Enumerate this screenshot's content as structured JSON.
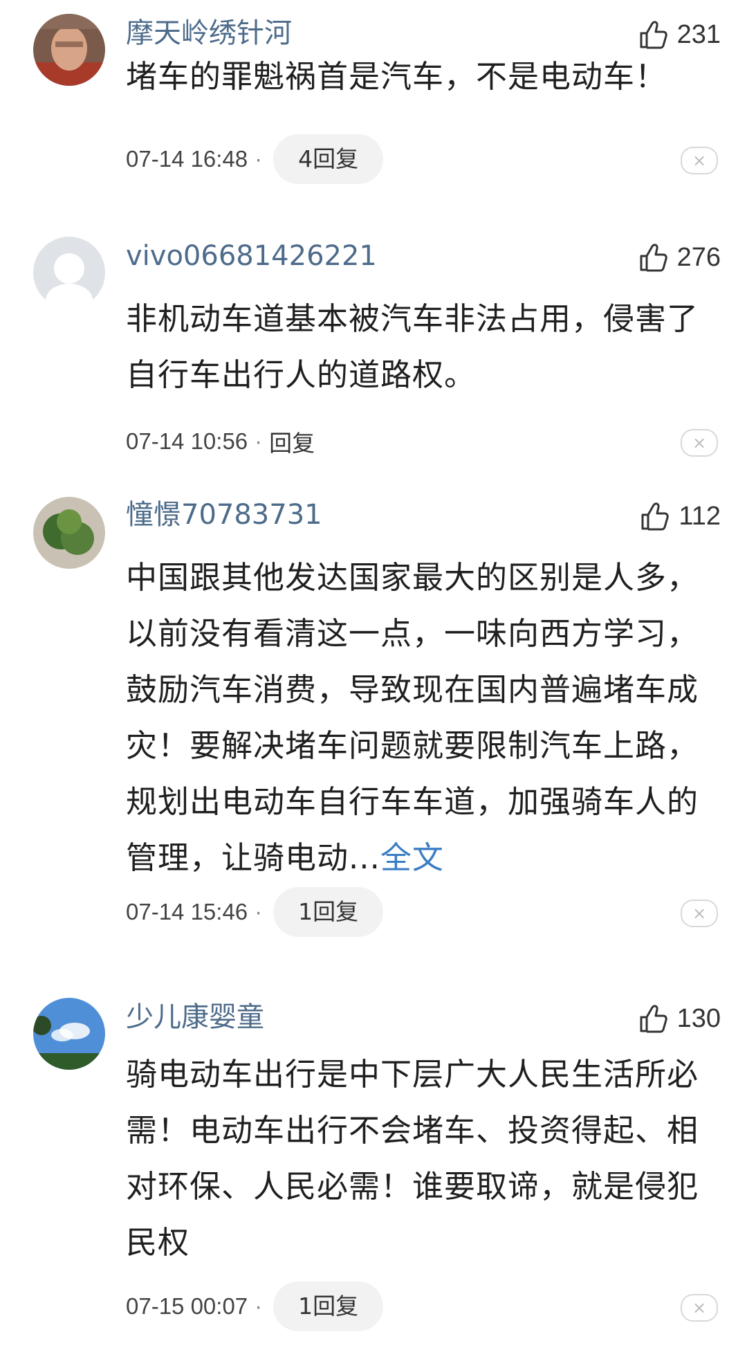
{
  "comments": [
    {
      "username": "摩天岭绣针河",
      "likes": "231",
      "text": "堵车的罪魁祸首是汽车，不是电动车！",
      "more": "",
      "time": "07-14 16:48",
      "reply": "4回复"
    },
    {
      "username": "vivo06681426221",
      "likes": "276",
      "text": "非机动车道基本被汽车非法占用，侵害了自行车出行人的道路权。",
      "more": "",
      "time": "07-14 10:56",
      "reply": "回复"
    },
    {
      "username": "憧憬70783731",
      "likes": "112",
      "text": "中国跟其他发达国家最大的区别是人多，以前没有看清这一点，一味向西方学习，鼓励汽车消费，导致现在国内普遍堵车成灾！要解决堵车问题就要限制汽车上路，规划出电动车自行车车道，加强骑车人的管理，让骑电动...",
      "more": "全文",
      "time": "07-14 15:46",
      "reply": "1回复"
    },
    {
      "username": "少儿康婴童",
      "likes": "130",
      "text": "骑电动车出行是中下层广大人民生活所必需！电动车出行不会堵车、投资得起、相对环保、人民必需！谁要取谛，就是侵犯民权",
      "more": "",
      "time": "07-15 00:07",
      "reply": "1回复"
    }
  ],
  "meta_separator": "·",
  "close_glyph": "×",
  "icons": {
    "like": "thumbs-up-icon",
    "close": "close-icon"
  },
  "colors": {
    "username": "#4d6b8a",
    "link": "#3b7dc4",
    "pill_bg": "#f2f2f2"
  }
}
